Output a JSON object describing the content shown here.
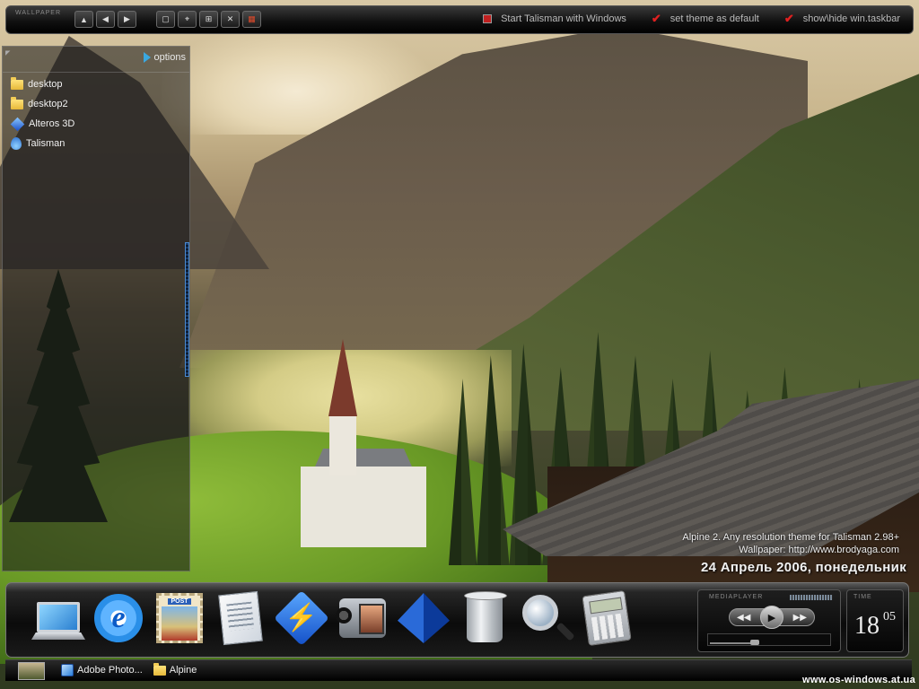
{
  "topbar": {
    "title": "WALLPAPER",
    "nav_buttons": [
      {
        "name": "nav-up-button",
        "icon": "▲"
      },
      {
        "name": "nav-back-button",
        "icon": "◀"
      },
      {
        "name": "nav-forward-button",
        "icon": "▶"
      }
    ],
    "tool_buttons": [
      {
        "name": "window-button",
        "icon": "▢"
      },
      {
        "name": "crosshair-button",
        "icon": "⌖"
      },
      {
        "name": "grid-button",
        "icon": "⊞"
      },
      {
        "name": "close-button",
        "icon": "✕"
      },
      {
        "name": "color-button",
        "icon": "▦"
      }
    ],
    "options": {
      "start_with_windows": "Start Talisman with Windows",
      "set_theme_default": "set theme as default",
      "show_hide_taskbar": "show\\hide win.taskbar"
    }
  },
  "panel": {
    "options_label": "options",
    "items": [
      {
        "label": "desktop",
        "icon": "folder-icon"
      },
      {
        "label": "desktop2",
        "icon": "folder-icon"
      },
      {
        "label": "Alteros 3D",
        "icon": "diamond-icon"
      },
      {
        "label": "Talisman",
        "icon": "drop-icon"
      }
    ]
  },
  "info": {
    "theme_line": "Alpine 2. Any resolution theme for Talisman 2.98+",
    "wallpaper_line": "Wallpaper:  http://www.brodyaga.com",
    "date": "24 Апрель 2006, понедельник"
  },
  "dock": {
    "icons": [
      "laptop-icon",
      "internet-explorer-icon",
      "post-stamp-icon",
      "document-icon",
      "winamp-icon",
      "video-camera-icon",
      "pyramid-icon",
      "trash-can-icon",
      "magnifier-icon",
      "calculator-icon"
    ],
    "ie_glyph": "e",
    "stamp_label": "POST",
    "bolt_glyph": "⚡",
    "mediaplayer": {
      "title": "MEDIAPLAYER",
      "prev": "◀◀",
      "play": "▶",
      "next": "▶▶",
      "progress": 0.35
    },
    "clock": {
      "title": "TIME",
      "hours": "18",
      "minutes": "05"
    }
  },
  "taskbar": {
    "items": [
      {
        "label": "Adobe Photo...",
        "icon": "photoshop-icon"
      },
      {
        "label": "Alpine",
        "icon": "folder-icon"
      }
    ]
  },
  "site": "www.os-windows.at.ua"
}
